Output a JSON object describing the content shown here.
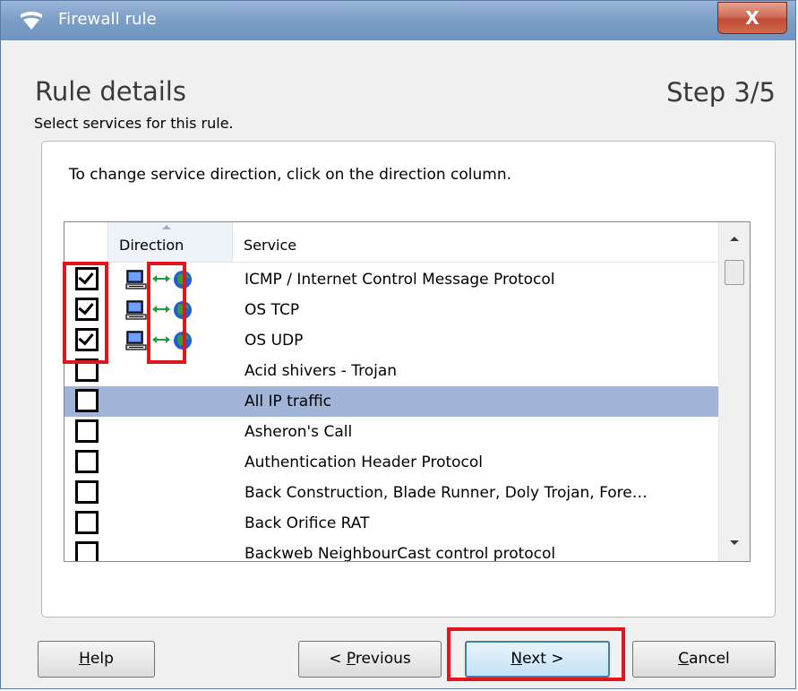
{
  "window": {
    "title": "Firewall rule",
    "close_label": "X"
  },
  "header": {
    "title": "Rule details",
    "step": "Step 3/5",
    "subtitle": "Select services for this rule."
  },
  "instruction": "To change service direction, click on the direction column.",
  "table": {
    "columns": [
      "Direction",
      "Service"
    ],
    "rows": [
      {
        "checked": true,
        "direction": "bidirectional",
        "service": "ICMP / Internet Control Message Protocol"
      },
      {
        "checked": true,
        "direction": "bidirectional",
        "service": "OS TCP"
      },
      {
        "checked": true,
        "direction": "bidirectional",
        "service": "OS UDP"
      },
      {
        "checked": false,
        "direction": "",
        "service": "Acid shivers - Trojan"
      },
      {
        "checked": false,
        "direction": "",
        "service": "All IP traffic",
        "selected": true
      },
      {
        "checked": false,
        "direction": "",
        "service": "Asheron's Call"
      },
      {
        "checked": false,
        "direction": "",
        "service": "Authentication Header Protocol"
      },
      {
        "checked": false,
        "direction": "",
        "service": "Back Construction, Blade Runner, Doly Trojan, Fore…"
      },
      {
        "checked": false,
        "direction": "",
        "service": "Back Orifice RAT"
      },
      {
        "checked": false,
        "direction": "",
        "service": "Backweb NeighbourCast control protocol"
      }
    ]
  },
  "buttons": {
    "help": {
      "pre": "",
      "ul": "H",
      "post": "elp"
    },
    "previous": {
      "pre": "< ",
      "ul": "P",
      "post": "revious"
    },
    "next": {
      "pre": "",
      "ul": "N",
      "post": "ext >"
    },
    "cancel": {
      "pre": "",
      "ul": "C",
      "post": "ancel"
    }
  },
  "colors": {
    "highlight": "#e0161f",
    "selected_row": "#9fb4d7",
    "titlebar": "#7d9fc8"
  }
}
